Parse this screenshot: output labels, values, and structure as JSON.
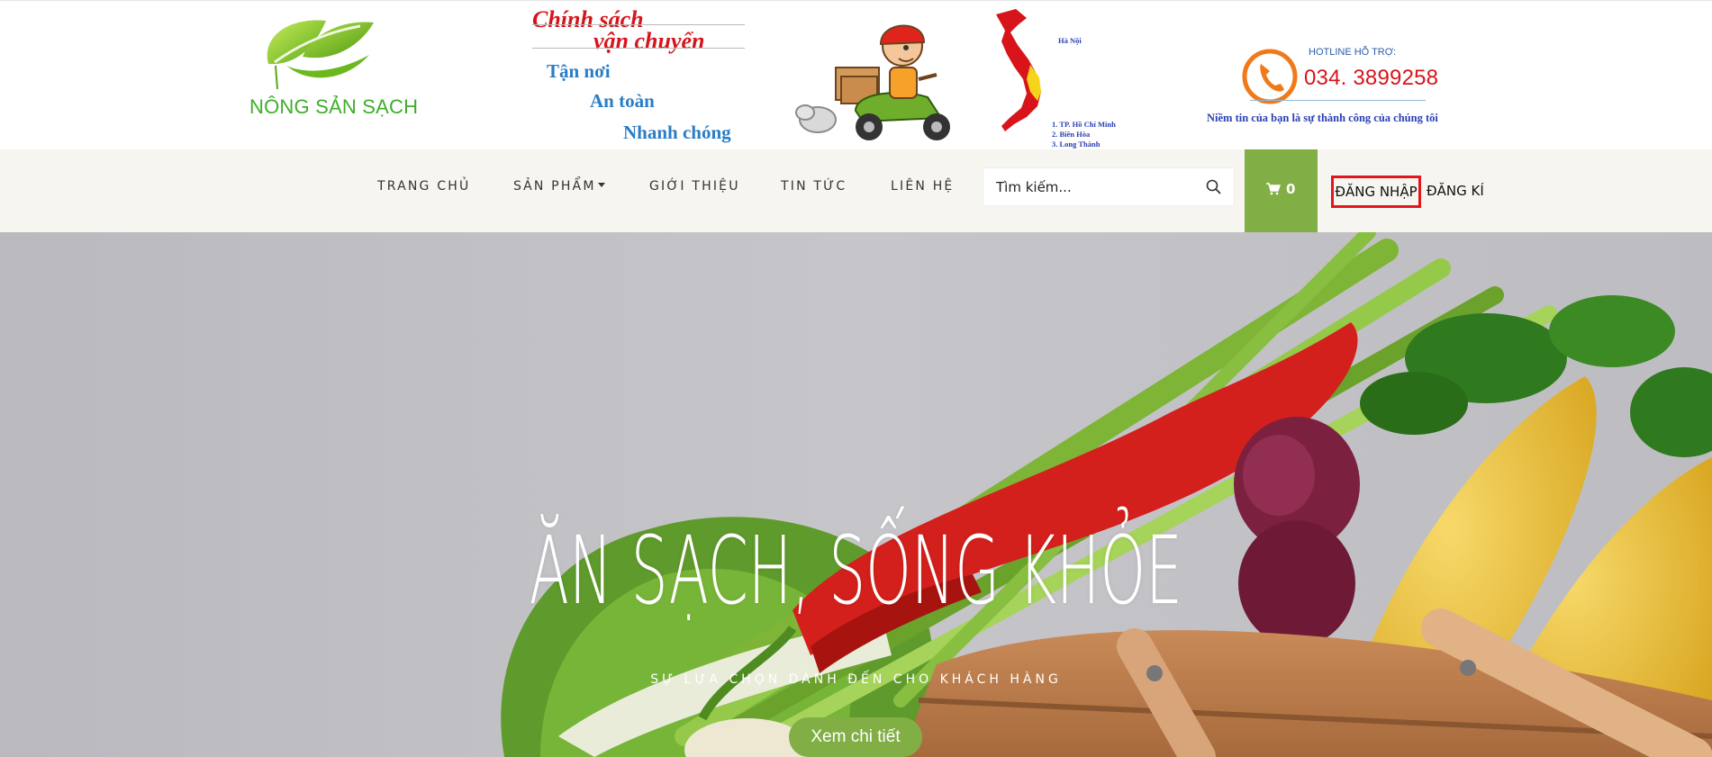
{
  "brand": {
    "logo_text": "NÔNG SẢN SẠCH",
    "leaf_color": "#7fc31c",
    "text_color": "#3fae2a"
  },
  "shipping_banner": {
    "title_line1": "Chính sách",
    "title_line2": "vận chuyển",
    "lines": [
      "Tận nơi",
      "An toàn",
      "Nhanh chóng"
    ],
    "title_color": "#d8141b",
    "line_color": "#2a7dc6"
  },
  "coverage_map": {
    "north_label": "Hà Nội",
    "south_list": [
      "1. TP. Hồ Chí Minh",
      "2. Biên Hòa",
      "3. Long Thành"
    ],
    "map_color": "#d8141b",
    "highlight_color": "#f5d51a"
  },
  "hotline": {
    "label": "HOTLINE HỖ TRỢ:",
    "number": "034. 3899258",
    "slogan": "Niềm tin của bạn là sự thành công của chúng tôi",
    "icon": "phone-icon",
    "icon_color": "#f07a1a"
  },
  "nav": {
    "items": [
      {
        "label": "TRANG CHỦ"
      },
      {
        "label": "SẢN PHẨM",
        "dropdown": true
      },
      {
        "label": "GIỚI THIỆU"
      },
      {
        "label": "TIN TỨC"
      },
      {
        "label": "LIÊN HỆ"
      }
    ],
    "search_placeholder": "Tìm kiếm...",
    "search_icon": "search-icon",
    "cart_count": "0",
    "cart_icon": "cart-icon",
    "login_label": "ĐĂNG NHẬP",
    "register_label": "ĐĂNG KÍ",
    "accent": "#82ae46",
    "highlight_border": "#e3151d"
  },
  "hero": {
    "title": "ĂN SẠCH, SỐNG KHỎE",
    "subtitle": "SỰ LỰA CHỌN DÀNH ĐẾN CHO KHÁCH HÀNG",
    "button_label": "Xem chi tiết",
    "image_subject": "vegetables-basket-photo"
  }
}
